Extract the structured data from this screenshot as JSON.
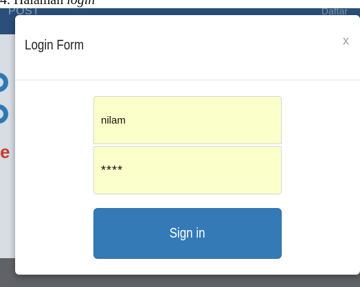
{
  "caption": {
    "prefix": "4.",
    "text": "Halaman",
    "italic": "login"
  },
  "navbar": {
    "brand": "POST",
    "link": "Daftar"
  },
  "backdrop": {
    "logo_letter": "e"
  },
  "modal": {
    "title": "Login Form",
    "close_label": "x",
    "username_value": "nilam",
    "password_value": "****",
    "submit_label": "Sign in"
  },
  "colors": {
    "navbar": "#2a4f78",
    "button": "#337ab7",
    "input_background": "#fbffc9",
    "logo_blue": "#2d79b5",
    "logo_red": "#c83b2e"
  }
}
